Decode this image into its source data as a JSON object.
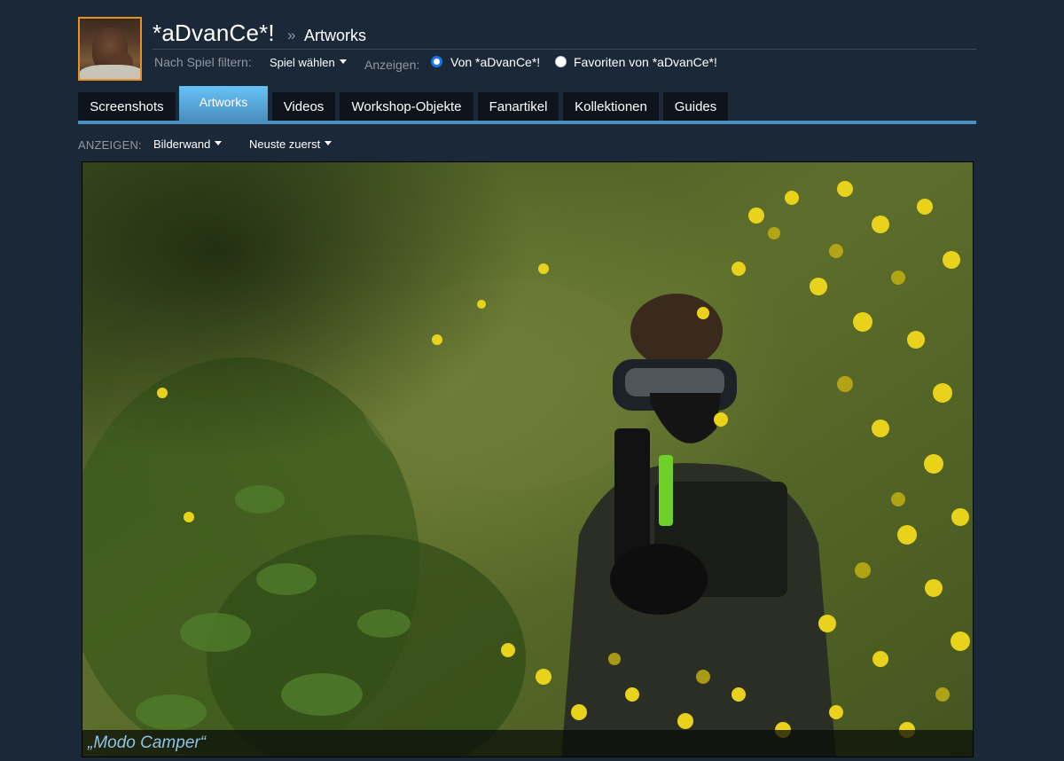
{
  "profile": {
    "username": "*aDvanCe*!",
    "breadcrumb_separator": "»",
    "section": "Artworks",
    "avatar_icon": "user-avatar"
  },
  "filters": {
    "game_filter_label": "Nach Spiel filtern:",
    "game_dropdown": "Spiel wählen",
    "show_label": "Anzeigen:",
    "options": [
      {
        "label": "Von *aDvanCe*!",
        "selected": true
      },
      {
        "label": "Favoriten von *aDvanCe*!",
        "selected": false
      }
    ]
  },
  "tabs": [
    {
      "label": "Screenshots",
      "active": false
    },
    {
      "label": "Artworks",
      "active": true
    },
    {
      "label": "Videos",
      "active": false
    },
    {
      "label": "Workshop-Objekte",
      "active": false
    },
    {
      "label": "Fanartikel",
      "active": false
    },
    {
      "label": "Kollektionen",
      "active": false
    },
    {
      "label": "Guides",
      "active": false
    }
  ],
  "view": {
    "label": "ANZEIGEN:",
    "layout_dropdown": "Bilderwand",
    "sort_dropdown": "Neuste zuerst"
  },
  "artwork": {
    "caption": "„Modo Camper“"
  },
  "colors": {
    "background": "#1b2838",
    "accent": "#67c1f5",
    "tab_inactive": "#0e141b",
    "avatar_border": "#e6902a",
    "caption": "#8fc3e6"
  }
}
